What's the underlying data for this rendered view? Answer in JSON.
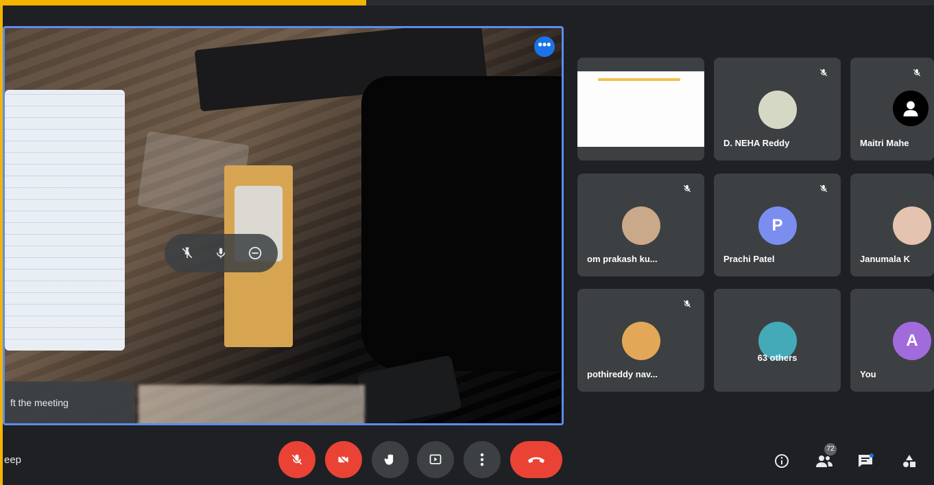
{
  "main_video": {
    "toast_text": "ft the meeting",
    "more_button_glyph": "•••",
    "hover_controls": {
      "pin_icon": "pin-off-icon",
      "mic_icon": "mic-icon",
      "remove_icon": "remove-icon"
    }
  },
  "participants": [
    {
      "name": "",
      "type": "presentation",
      "muted": false
    },
    {
      "name": "D. NEHA Reddy",
      "type": "avatar",
      "muted": true,
      "avatar_color": "#d6d8c6",
      "initial": ""
    },
    {
      "name": "Maitri Mahe",
      "type": "avatar",
      "muted": true,
      "avatar_color": "#ffffff",
      "initial": ""
    },
    {
      "name": "om prakash ku...",
      "type": "avatar",
      "muted": true,
      "avatar_color": "#c9a98a",
      "initial": ""
    },
    {
      "name": "Prachi Patel",
      "type": "avatar",
      "muted": true,
      "avatar_color": "#7b8ef0",
      "initial": "P"
    },
    {
      "name": "Janumala K",
      "type": "avatar",
      "muted": false,
      "avatar_color": "#e4c3b0",
      "initial": ""
    },
    {
      "name": "pothireddy nav...",
      "type": "avatar",
      "muted": true,
      "avatar_color": "#e3a857",
      "initial": ""
    },
    {
      "name": "63 others",
      "type": "group",
      "muted": false,
      "avatar_color": "#45aab8",
      "initial": ""
    },
    {
      "name": "You",
      "type": "avatar",
      "muted": false,
      "avatar_color": "#a26bdc",
      "initial": "A"
    }
  ],
  "bottom_bar": {
    "left_text": "eep",
    "people_count": "72",
    "controls": [
      "mic-off",
      "camera-off",
      "raise-hand",
      "present",
      "more",
      "end-call"
    ]
  },
  "colors": {
    "accent_yellow": "#f4b400",
    "accent_blue": "#5b8def",
    "danger": "#ea4335"
  }
}
